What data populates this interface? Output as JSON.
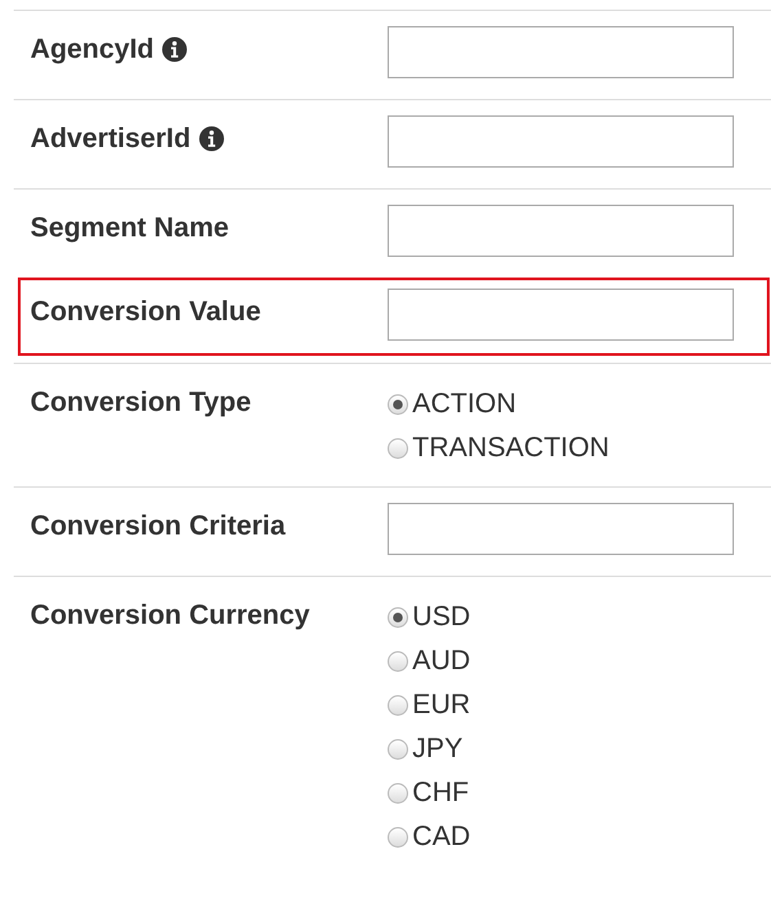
{
  "fields": [
    {
      "label": "AgencyId",
      "kind": "text",
      "info": true,
      "highlighted": false
    },
    {
      "label": "AdvertiserId",
      "kind": "text",
      "info": true,
      "highlighted": false
    },
    {
      "label": "Segment Name",
      "kind": "text",
      "info": false,
      "highlighted": false
    },
    {
      "label": "Conversion Value",
      "kind": "text",
      "info": false,
      "highlighted": true
    },
    {
      "label": "Conversion Type",
      "kind": "radio",
      "info": false,
      "highlighted": false,
      "options": [
        {
          "label": "ACTION",
          "selected": true
        },
        {
          "label": "TRANSACTION",
          "selected": false
        }
      ]
    },
    {
      "label": "Conversion Criteria",
      "kind": "text",
      "info": false,
      "highlighted": false
    },
    {
      "label": "Conversion Currency",
      "kind": "radio",
      "info": false,
      "highlighted": false,
      "options": [
        {
          "label": "USD",
          "selected": true
        },
        {
          "label": "AUD",
          "selected": false
        },
        {
          "label": "EUR",
          "selected": false
        },
        {
          "label": "JPY",
          "selected": false
        },
        {
          "label": "CHF",
          "selected": false
        },
        {
          "label": "CAD",
          "selected": false
        }
      ]
    }
  ]
}
